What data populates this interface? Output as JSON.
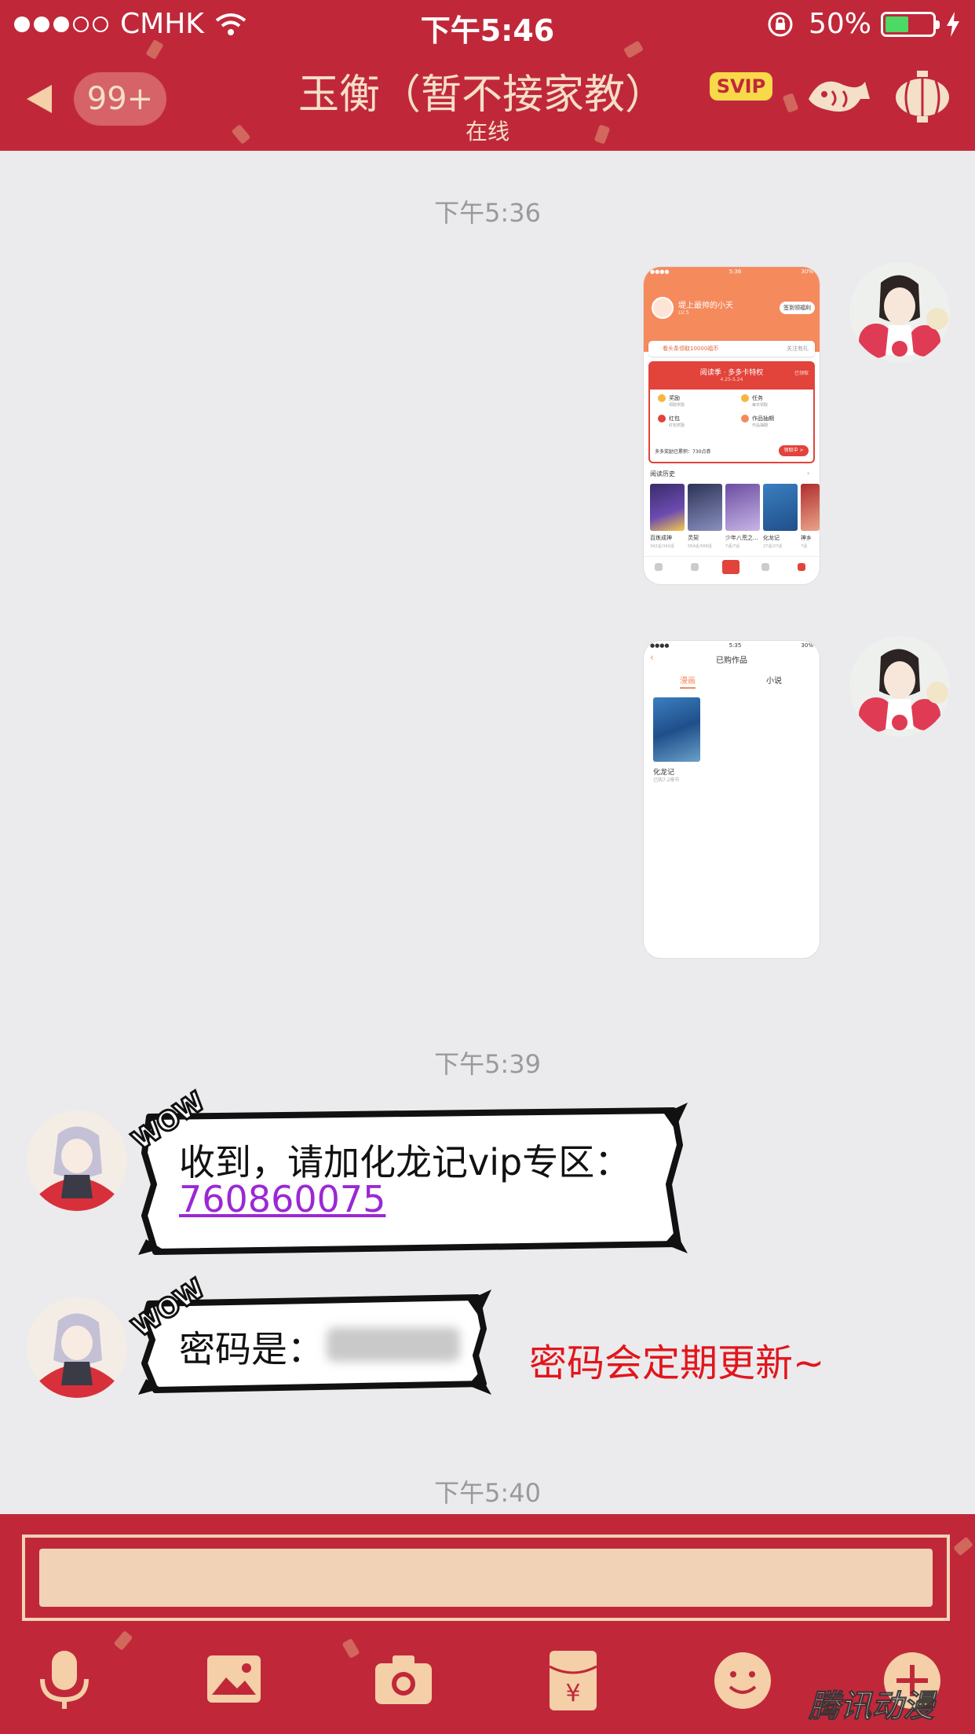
{
  "status_bar": {
    "carrier": "CMHK",
    "time": "下午5:46",
    "battery_percent": "50%",
    "battery_level": 0.5
  },
  "header": {
    "unread_count": "99+",
    "title": "玉衡（暂不接家教）",
    "badge": "SVIP",
    "presence": "在线",
    "colors": {
      "bar": "#c0283a",
      "text": "#f4dfc9"
    }
  },
  "messages": {
    "timestamp_1": "下午5:36",
    "timestamp_2": "下午5:39",
    "timestamp_3": "下午5:40",
    "screenshot_1": {
      "name": "堤上最帅的小天",
      "banner_line": "看头条领取10000福币",
      "banner_right": "关注有礼",
      "card_title": "阅读季 · 多多卡特权",
      "card_dates": "4.25-5.24",
      "card_tag": "已领取",
      "items": [
        "奖励",
        "任务",
        "红包",
        "作品抽期"
      ],
      "footer_text": "多多奖励已累积：730点券",
      "footer_button": "领取中 >",
      "history_title": "阅读历史",
      "books": [
        {
          "title": "百炼成神",
          "sub": "342话/342话"
        },
        {
          "title": "灵契",
          "sub": "564话/568话"
        },
        {
          "title": "少年八荒之...",
          "sub": "7话/7话"
        },
        {
          "title": "化龙记",
          "sub": "27话/27话"
        },
        {
          "title": "神乡",
          "sub": "7话"
        }
      ]
    },
    "screenshot_2": {
      "page_title": "已购作品",
      "tab_active": "漫画",
      "tab_other": "小说",
      "book_title": "化龙记",
      "book_sub": "已购7.2章节"
    },
    "bubble_1": {
      "text": "收到，请加化龙记vip专区：",
      "link": "760860075"
    },
    "bubble_2": {
      "text": "密码是："
    },
    "wow_label": "WOW",
    "note": "密码会定期更新~"
  },
  "input": {
    "placeholder": ""
  },
  "toolbar": {
    "icons": [
      "microphone-icon",
      "image-icon",
      "camera-icon",
      "red-packet-icon",
      "emoji-icon",
      "plus-icon"
    ]
  },
  "watermark": "腾讯动漫"
}
